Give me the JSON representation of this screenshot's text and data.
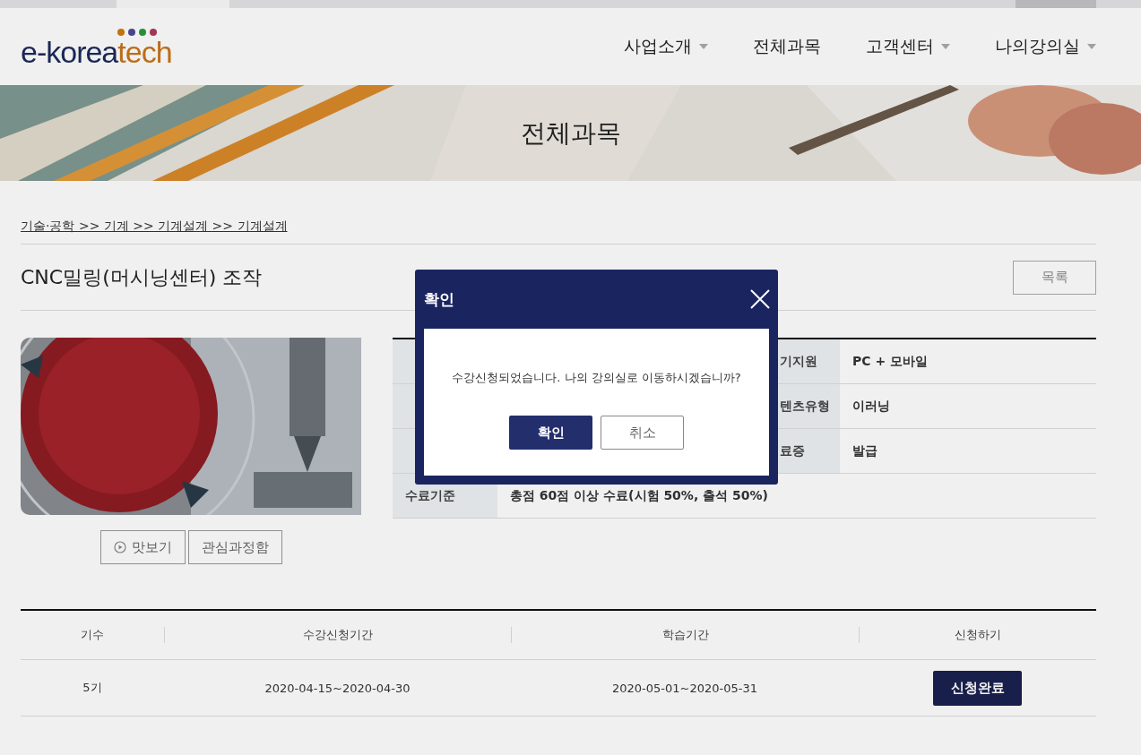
{
  "logo": {
    "text_1": "e-korea",
    "text_2": "tech"
  },
  "nav": [
    {
      "label": "사업소개",
      "has_menu": true
    },
    {
      "label": "전체과목",
      "has_menu": false
    },
    {
      "label": "고객센터",
      "has_menu": true
    },
    {
      "label": "나의강의실",
      "has_menu": true
    }
  ],
  "banner": {
    "title": "전체과목"
  },
  "breadcrumb": "기술·공학 >> 기계 >> 기계설계 >> 기계설계",
  "course": {
    "title": "CNC밀링(머시닝센터) 조작",
    "list_button": "목록",
    "buttons": [
      {
        "label": "맛보기",
        "kind": "preview"
      },
      {
        "label": "관심과정함",
        "kind": "plain"
      }
    ]
  },
  "info_rows": [
    {
      "kind": "split",
      "label_2": "기지원",
      "value_2": "PC + 모바일"
    },
    {
      "kind": "split",
      "label_2": "텐츠유형",
      "value_2": "이러닝"
    },
    {
      "kind": "split",
      "label_2": "료증",
      "value_2": "발급"
    },
    {
      "kind": "full",
      "label_1": "수료기준",
      "value_1": "총점 60점 이상 수료(시험 50%, 출석 50%)"
    }
  ],
  "sessions": {
    "columns": [
      "기수",
      "수강신청기간",
      "학습기간",
      "신청하기"
    ],
    "rows": [
      {
        "session": "5기",
        "apply_period": "2020-04-15~2020-04-30",
        "study_period": "2020-05-01~2020-05-31",
        "action": "신청완료"
      }
    ]
  },
  "dialog": {
    "title": "확인",
    "message": "수강신청되었습니다. 나의 강의실로 이동하시겠습니까?",
    "confirm": "확인",
    "cancel": "취소"
  }
}
